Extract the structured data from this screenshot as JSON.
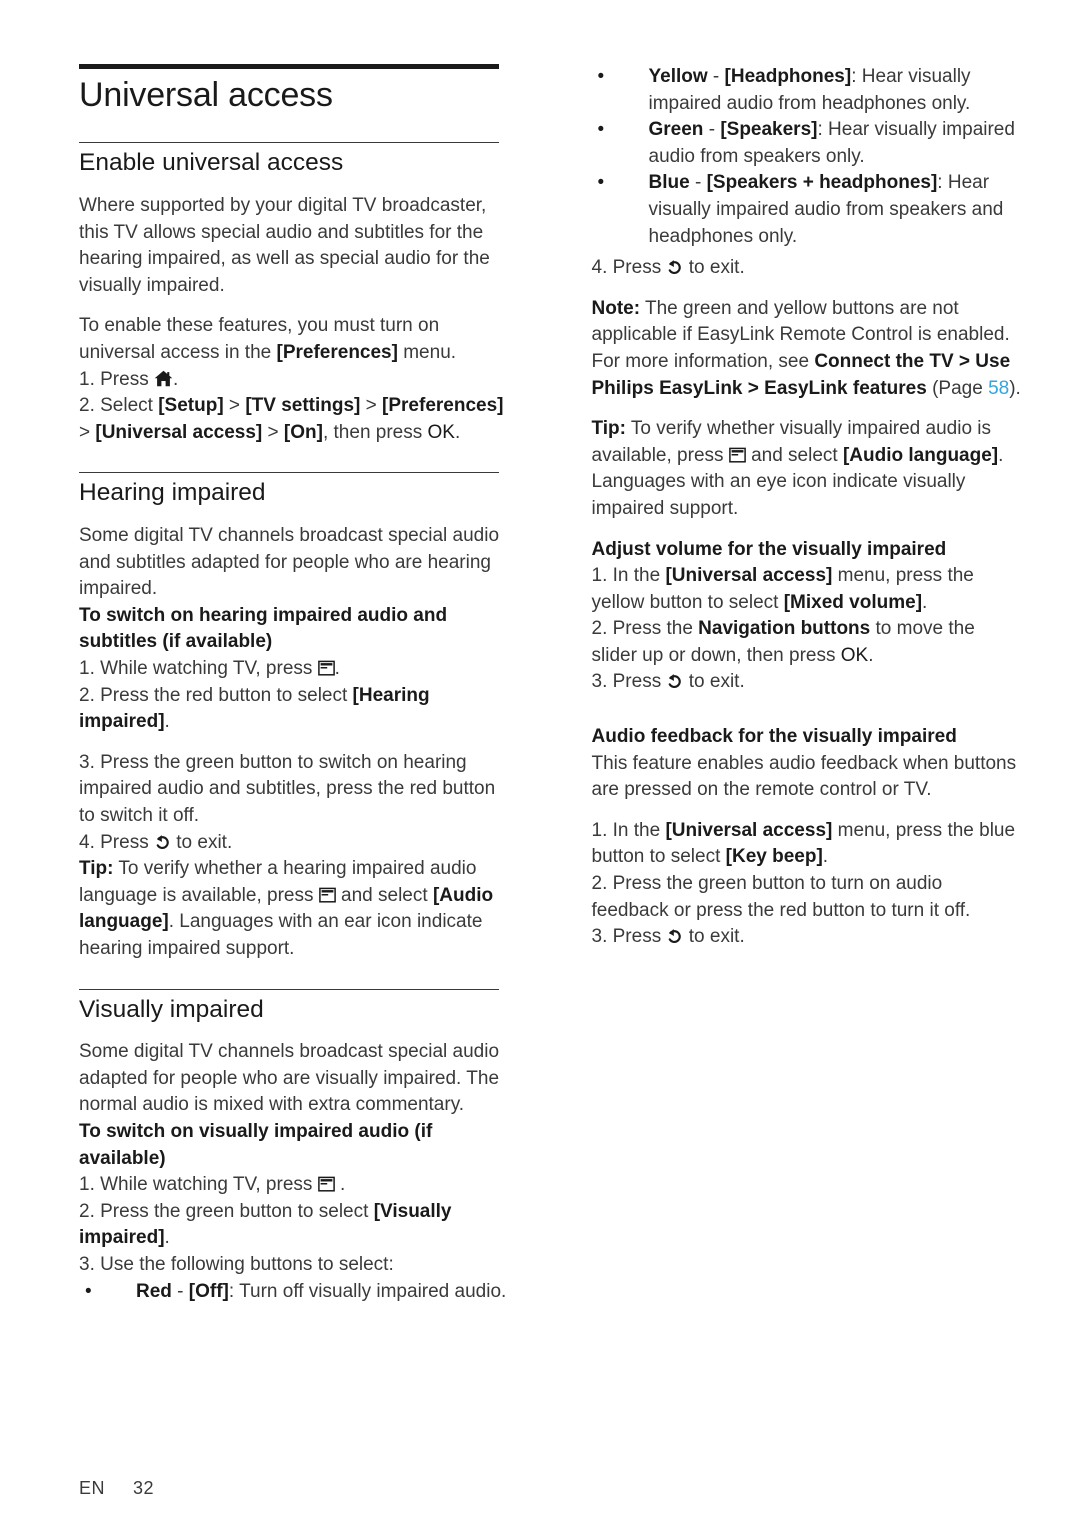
{
  "page": {
    "title": "Universal access",
    "footer_language": "EN",
    "footer_page_number": "32",
    "link_color": "#33a5dd",
    "text_color": "#3a3a3a",
    "heading_color": "#1a1a1a"
  },
  "left_column": {
    "section1": {
      "heading": "Enable universal access",
      "para1": "Where supported by your digital TV broadcaster, this TV allows special audio and subtitles for the hearing impaired, as well as special audio for the visually impaired.",
      "para2_a": "To enable these features, you must turn on universal access in the ",
      "para2_bold": "[Preferences]",
      "para2_b": " menu.",
      "step1_a": "1. Press ",
      "step1_icon": "home-icon",
      "step1_b": ".",
      "step2_a": "2. Select ",
      "step2_b1": "[Setup]",
      "step2_sep1": " > ",
      "step2_b2": "[TV settings]",
      "step2_sep2": " > ",
      "step2_b3": "[Preferences]",
      "step2_sep3": " > ",
      "step2_b4": "[Universal access]",
      "step2_sep4": " > ",
      "step2_b5": "[On]",
      "step2_c": ", then press ",
      "step2_ok": "OK",
      "step2_d": "."
    },
    "section2": {
      "heading": "Hearing impaired",
      "para1": "Some digital TV channels broadcast special audio and subtitles adapted for people who are hearing impaired.",
      "subhead": "To switch on hearing impaired audio and subtitles (if available)",
      "step1_a": "1. While watching TV, press ",
      "step1_icon": "options-icon",
      "step1_b": ".",
      "step2_a": "2. Press the red button to select ",
      "step2_bold": "[Hearing impaired]",
      "step2_b": ".",
      "step3": "3. Press the green button to switch on hearing impaired audio and subtitles, press the red button to switch it off.",
      "step4_a": "4. Press ",
      "step4_icon": "back-icon",
      "step4_b": " to exit.",
      "tip_label": "Tip:",
      "tip_a": " To verify whether a hearing impaired audio language is available, press ",
      "tip_icon": "options-icon",
      "tip_b": " and select ",
      "tip_bold": "[Audio language]",
      "tip_c": ". Languages with an ear icon indicate hearing impaired support."
    },
    "section3": {
      "heading": "Visually impaired",
      "para1": "Some digital TV channels broadcast special audio adapted for people who are visually impaired. The normal audio is mixed with extra commentary.",
      "subhead": "To switch on visually impaired audio (if available)",
      "step1_a": "1. While watching TV, press ",
      "step1_icon": "options-icon",
      "step1_b": " .",
      "step2_a": "2. Press the green button to select ",
      "step2_bold": "[Visually impaired]",
      "step2_b": ".",
      "step3": "3. Use the following buttons to select:",
      "bullets": [
        {
          "bold1": "Red",
          "sep": " - ",
          "bold2": "[Off]",
          "rest": ": Turn off visually impaired audio."
        }
      ]
    }
  },
  "right_column": {
    "bullets": [
      {
        "bold1": "Yellow",
        "sep": " - ",
        "bold2": "[Headphones]",
        "rest": ": Hear visually impaired audio from headphones only."
      },
      {
        "bold1": "Green",
        "sep": " - ",
        "bold2": "[Speakers]",
        "rest": ": Hear visually impaired audio from speakers only."
      },
      {
        "bold1": "Blue",
        "sep": " - ",
        "bold2": "[Speakers + headphones]",
        "rest": ": Hear visually impaired audio from speakers and headphones only."
      }
    ],
    "step4_a": "4. Press ",
    "step4_icon": "back-icon",
    "step4_b": " to exit.",
    "note": {
      "label": "Note:",
      "text_a": " The green and yellow buttons are not applicable if EasyLink Remote Control is enabled. For more information, see ",
      "bold_path": "Connect the TV > Use Philips EasyLink > EasyLink features",
      "text_b": " (Page ",
      "page_link": "58",
      "text_c": ")."
    },
    "tip": {
      "label": "Tip:",
      "text_a": " To verify whether visually impaired audio is available, press ",
      "icon": "options-icon",
      "text_b": " and select ",
      "bold": "[Audio language]",
      "text_c": ". Languages with an eye icon indicate visually impaired support."
    },
    "section_volume": {
      "subhead": "Adjust volume for the visually impaired",
      "step1_a": "1. In the ",
      "step1_bold1": "[Universal access]",
      "step1_b": " menu, press the yellow button to select ",
      "step1_bold2": "[Mixed volume]",
      "step1_c": ".",
      "step2_a": "2. Press the ",
      "step2_bold": "Navigation buttons",
      "step2_b": " to move the slider up or down, then press ",
      "step2_ok": "OK",
      "step2_c": ".",
      "step3_a": "3. Press ",
      "step3_icon": "back-icon",
      "step3_b": " to exit."
    },
    "section_feedback": {
      "subhead": "Audio feedback for the visually impaired",
      "para1": "This feature enables audio feedback when buttons are pressed on the remote control or TV.",
      "step1_a": "1. In the ",
      "step1_bold1": "[Universal access]",
      "step1_b": " menu, press the blue button to select ",
      "step1_bold2": "[Key beep]",
      "step1_c": ".",
      "step2": "2. Press the green button to turn on audio feedback or press the red button to turn it off.",
      "step3_a": "3. Press ",
      "step3_icon": "back-icon",
      "step3_b": " to exit."
    }
  },
  "icons": {
    "home-icon": "home",
    "options-icon": "options",
    "back-icon": "back-arrow",
    "bullet-dot": "•"
  }
}
